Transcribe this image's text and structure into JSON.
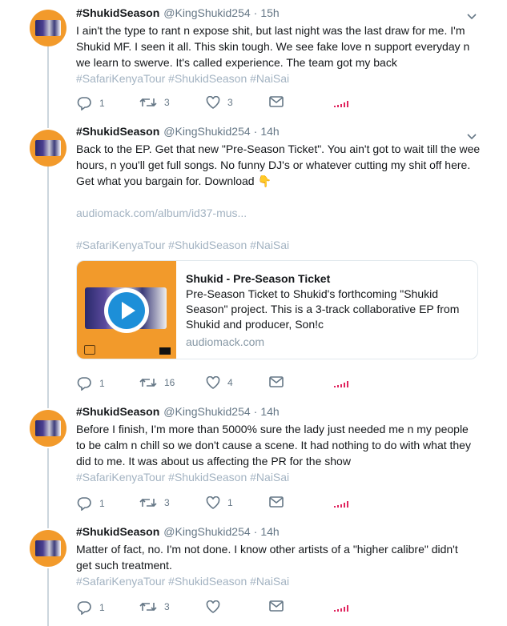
{
  "colors": {
    "link": "#a3b3c2",
    "muted": "#657786",
    "analytics": "#e0245e",
    "avatar_bg": "#f29a2b",
    "play": "#1d8fd8"
  },
  "tweets": [
    {
      "name": "#ShukidSeason",
      "handle": "@KingShukid254",
      "separator": "·",
      "time": "15h",
      "lines": [
        "I ain't the type to rant n expose shit, but last night was the last draw for me. I'm",
        "Shukid MF. I seen it all. This skin tough. We see fake love n support everyday n",
        "we learn to swerve. It's called experience. The team got my back"
      ],
      "hashtags": "#SafariKenyaTour #ShukidSeason #NaiSai",
      "replies": "1",
      "retweets": "3",
      "likes": "3"
    },
    {
      "name": "#ShukidSeason",
      "handle": "@KingShukid254",
      "separator": "·",
      "time": "14h",
      "lines": [
        "Back to the EP. Get that new \"Pre-Season Ticket\". You ain't got to wait till the wee",
        "hours, n you'll get full songs. No funny DJ's or whatever cutting my shit off here.",
        "Get what you bargain for. Download"
      ],
      "emoji": "👇",
      "link": "audiomack.com/album/id37-mus...",
      "hashtags": "#SafariKenyaTour #ShukidSeason #NaiSai",
      "card": {
        "title": "Shukid - Pre-Season Ticket",
        "desc_lines": [
          "Pre-Season Ticket to Shukid's forthcoming \"Shukid",
          "Season\" project. This is a 3-track collaborative EP from",
          "Shukid and producer, Son!c"
        ],
        "domain": "audiomack.com"
      },
      "replies": "1",
      "retweets": "16",
      "likes": "4"
    },
    {
      "name": "#ShukidSeason",
      "handle": "@KingShukid254",
      "separator": "·",
      "time": "14h",
      "lines": [
        "Before I finish, I'm more than 5000% sure the lady just needed me n my people",
        "to be calm n chill so we don't cause a scene. It had nothing to do with what they",
        "did to me. It was about us affecting the PR for the show"
      ],
      "hashtags": "#SafariKenyaTour #ShukidSeason #NaiSai",
      "replies": "1",
      "retweets": "3",
      "likes": "1"
    },
    {
      "name": "#ShukidSeason",
      "handle": "@KingShukid254",
      "separator": "·",
      "time": "14h",
      "lines": [
        "Matter of fact, no. I'm not done. I know other artists of a \"higher calibre\" didn't",
        "get such treatment."
      ],
      "hashtags": "#SafariKenyaTour #ShukidSeason #NaiSai",
      "replies": "1",
      "retweets": "3",
      "likes": ""
    }
  ]
}
